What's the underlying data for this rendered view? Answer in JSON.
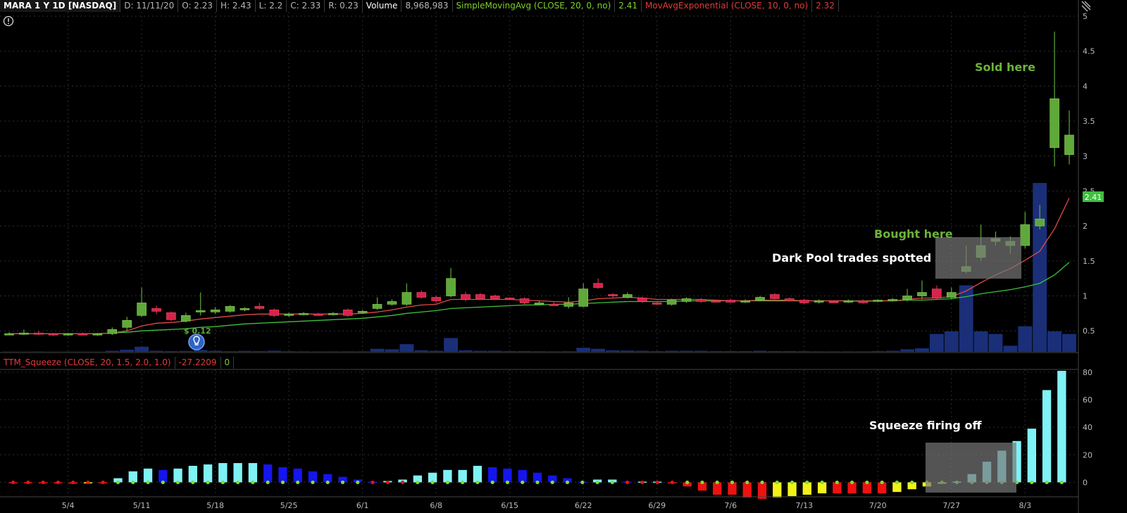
{
  "header": {
    "symbol": "MARA 1 Y 1D [NASDAQ]",
    "date": "D: 11/11/20",
    "open": "O: 2.23",
    "high": "H: 2.43",
    "low": "L: 2.2",
    "close": "C: 2.33",
    "range": "R: 0.23",
    "volume_label": "Volume",
    "volume_value": "8,968,983",
    "sma_label": "SimpleMovingAvg (CLOSE, 20, 0, no)",
    "sma_value": "2.41",
    "ema_label": "MovAvgExponential (CLOSE, 10, 0, no)",
    "ema_value": "2.32"
  },
  "squeeze_header": {
    "label": "TTM_Squeeze (CLOSE, 20, 1.5, 2.0, 1.0)",
    "value": "-27.2209",
    "signal": "0"
  },
  "price_badge": "2.41",
  "dividend_label": "$ 0.12",
  "annotations": {
    "sold": "Sold here",
    "bought": "Bought here",
    "dark_pool": "Dark Pool trades spotted",
    "squeeze": "Squeeze firing off"
  },
  "colors": {
    "up": "#5fa83a",
    "down": "#d8234a",
    "volume": "#1a2f78",
    "sma": "#3fbf3f",
    "ema": "#e04a4a",
    "grid": "#2e2e2e",
    "sq_pos_up": "#7ff2f5",
    "sq_pos_down": "#1515ee",
    "sq_neg_down": "#ee1111",
    "sq_neg_up": "#f2f21a"
  },
  "chart_data": [
    {
      "type": "candlestick",
      "x_ticks": [
        "5/4",
        "5/11",
        "5/18",
        "5/25",
        "6/1",
        "6/8",
        "6/15",
        "6/22",
        "6/29",
        "7/6",
        "7/13",
        "7/20",
        "7/27",
        "8/3"
      ],
      "y_ticks": [
        "0.5",
        "1",
        "1.5",
        "2",
        "2.5",
        "3",
        "3.5",
        "4",
        "4.5",
        "5"
      ],
      "ylim": [
        0.2,
        5
      ],
      "candles": [
        [
          0.45,
          0.48,
          0.44,
          0.46
        ],
        [
          0.46,
          0.52,
          0.44,
          0.47
        ],
        [
          0.47,
          0.5,
          0.44,
          0.46
        ],
        [
          0.46,
          0.47,
          0.43,
          0.44
        ],
        [
          0.44,
          0.47,
          0.43,
          0.46
        ],
        [
          0.46,
          0.48,
          0.44,
          0.45
        ],
        [
          0.45,
          0.47,
          0.43,
          0.46
        ],
        [
          0.46,
          0.55,
          0.44,
          0.52
        ],
        [
          0.55,
          0.7,
          0.5,
          0.65
        ],
        [
          0.72,
          1.12,
          0.7,
          0.9
        ],
        [
          0.82,
          0.86,
          0.74,
          0.78
        ],
        [
          0.76,
          0.78,
          0.64,
          0.66
        ],
        [
          0.64,
          0.76,
          0.62,
          0.72
        ],
        [
          0.77,
          1.05,
          0.72,
          0.79
        ],
        [
          0.77,
          0.84,
          0.74,
          0.8
        ],
        [
          0.78,
          0.87,
          0.76,
          0.85
        ],
        [
          0.8,
          0.84,
          0.78,
          0.82
        ],
        [
          0.85,
          0.9,
          0.8,
          0.82
        ],
        [
          0.8,
          0.82,
          0.7,
          0.72
        ],
        [
          0.73,
          0.76,
          0.7,
          0.74
        ],
        [
          0.74,
          0.77,
          0.72,
          0.75
        ],
        [
          0.74,
          0.76,
          0.72,
          0.73
        ],
        [
          0.74,
          0.77,
          0.72,
          0.75
        ],
        [
          0.8,
          0.82,
          0.7,
          0.72
        ],
        [
          0.76,
          0.8,
          0.74,
          0.78
        ],
        [
          0.82,
          0.98,
          0.8,
          0.88
        ],
        [
          0.88,
          0.95,
          0.86,
          0.92
        ],
        [
          0.88,
          1.18,
          0.86,
          1.05
        ],
        [
          1.05,
          1.08,
          0.96,
          0.98
        ],
        [
          0.98,
          1.0,
          0.9,
          0.93
        ],
        [
          1.0,
          1.4,
          0.98,
          1.25
        ],
        [
          1.02,
          1.06,
          0.92,
          0.95
        ],
        [
          1.02,
          1.04,
          0.94,
          0.96
        ],
        [
          1.0,
          1.02,
          0.94,
          0.96
        ],
        [
          0.97,
          0.98,
          0.94,
          0.95
        ],
        [
          0.96,
          0.98,
          0.88,
          0.9
        ],
        [
          0.9,
          0.93,
          0.88,
          0.9
        ],
        [
          0.88,
          0.92,
          0.86,
          0.87
        ],
        [
          0.85,
          0.98,
          0.82,
          0.9
        ],
        [
          0.85,
          1.18,
          0.84,
          1.1
        ],
        [
          1.18,
          1.25,
          1.1,
          1.12
        ],
        [
          1.02,
          1.04,
          0.98,
          1.0
        ],
        [
          0.98,
          1.05,
          0.96,
          1.02
        ],
        [
          0.97,
          0.99,
          0.9,
          0.92
        ],
        [
          0.9,
          0.92,
          0.87,
          0.88
        ],
        [
          0.88,
          0.96,
          0.86,
          0.94
        ],
        [
          0.92,
          0.98,
          0.9,
          0.96
        ],
        [
          0.95,
          0.97,
          0.9,
          0.92
        ],
        [
          0.93,
          0.95,
          0.91,
          0.92
        ],
        [
          0.94,
          0.96,
          0.9,
          0.91
        ],
        [
          0.92,
          0.95,
          0.9,
          0.93
        ],
        [
          0.94,
          1.0,
          0.92,
          0.98
        ],
        [
          1.02,
          1.04,
          0.95,
          0.96
        ],
        [
          0.96,
          0.98,
          0.92,
          0.93
        ],
        [
          0.94,
          0.96,
          0.88,
          0.9
        ],
        [
          0.91,
          0.95,
          0.89,
          0.93
        ],
        [
          0.92,
          0.94,
          0.9,
          0.91
        ],
        [
          0.92,
          0.95,
          0.9,
          0.93
        ],
        [
          0.93,
          0.95,
          0.89,
          0.9
        ],
        [
          0.92,
          0.95,
          0.91,
          0.94
        ],
        [
          0.94,
          0.97,
          0.92,
          0.95
        ],
        [
          0.95,
          1.1,
          0.92,
          1.0
        ],
        [
          1.0,
          1.22,
          0.95,
          1.05
        ],
        [
          1.1,
          1.15,
          0.95,
          0.97
        ],
        [
          0.98,
          1.12,
          0.96,
          1.05
        ],
        [
          1.35,
          1.72,
          1.32,
          1.42
        ],
        [
          1.55,
          2.02,
          1.5,
          1.72
        ],
        [
          1.78,
          1.92,
          1.72,
          1.82
        ],
        [
          1.72,
          1.85,
          1.6,
          1.78
        ],
        [
          1.72,
          2.2,
          1.68,
          2.02
        ],
        [
          2.0,
          2.3,
          1.95,
          2.1
        ],
        [
          3.12,
          4.78,
          2.85,
          3.82
        ],
        [
          3.02,
          3.65,
          2.88,
          3.3
        ]
      ]
    },
    {
      "type": "bar",
      "name": "Volume",
      "values": [
        0.06,
        0.06,
        0.07,
        0.05,
        0.06,
        0.06,
        0.05,
        0.2,
        0.4,
        1.0,
        0.2,
        0.15,
        0.18,
        0.35,
        0.2,
        0.12,
        0.18,
        0.15,
        0.22,
        0.12,
        0.1,
        0.08,
        0.09,
        0.1,
        0.1,
        0.6,
        0.5,
        1.5,
        0.3,
        0.2,
        2.7,
        0.3,
        0.2,
        0.2,
        0.15,
        0.15,
        0.12,
        0.1,
        0.12,
        0.8,
        0.6,
        0.3,
        0.25,
        0.2,
        0.15,
        0.2,
        0.2,
        0.2,
        0.15,
        0.15,
        0.15,
        0.2,
        0.15,
        0.15,
        0.12,
        0.1,
        0.1,
        0.1,
        0.1,
        0.15,
        0.2,
        0.5,
        0.7,
        3.5,
        4.0,
        13.0,
        4.0,
        3.5,
        1.2,
        5.0,
        33.0,
        4.0,
        3.5
      ]
    },
    {
      "type": "line",
      "name": "SimpleMovingAvg (CLOSE, 20, 0, no)",
      "values": [
        0.46,
        0.46,
        0.46,
        0.46,
        0.46,
        0.46,
        0.46,
        0.47,
        0.48,
        0.5,
        0.51,
        0.52,
        0.53,
        0.55,
        0.56,
        0.58,
        0.6,
        0.61,
        0.62,
        0.63,
        0.64,
        0.65,
        0.66,
        0.67,
        0.68,
        0.7,
        0.72,
        0.75,
        0.77,
        0.79,
        0.82,
        0.83,
        0.84,
        0.85,
        0.86,
        0.87,
        0.87,
        0.88,
        0.88,
        0.89,
        0.9,
        0.91,
        0.92,
        0.92,
        0.92,
        0.92,
        0.93,
        0.93,
        0.93,
        0.93,
        0.93,
        0.93,
        0.93,
        0.93,
        0.93,
        0.93,
        0.93,
        0.93,
        0.93,
        0.93,
        0.93,
        0.94,
        0.94,
        0.95,
        0.96,
        0.99,
        1.03,
        1.06,
        1.09,
        1.13,
        1.18,
        1.3,
        1.48
      ]
    },
    {
      "type": "line",
      "name": "MovAvgExponential (CLOSE, 10, 0, no)",
      "values": [
        0.46,
        0.46,
        0.46,
        0.46,
        0.46,
        0.46,
        0.46,
        0.47,
        0.5,
        0.57,
        0.61,
        0.62,
        0.64,
        0.67,
        0.69,
        0.71,
        0.73,
        0.74,
        0.74,
        0.74,
        0.74,
        0.74,
        0.74,
        0.74,
        0.75,
        0.77,
        0.8,
        0.84,
        0.87,
        0.88,
        0.95,
        0.95,
        0.95,
        0.95,
        0.95,
        0.94,
        0.93,
        0.92,
        0.91,
        0.93,
        0.96,
        0.97,
        0.98,
        0.97,
        0.95,
        0.95,
        0.95,
        0.95,
        0.94,
        0.93,
        0.93,
        0.94,
        0.94,
        0.94,
        0.93,
        0.93,
        0.93,
        0.93,
        0.92,
        0.93,
        0.93,
        0.95,
        0.97,
        0.97,
        0.99,
        1.07,
        1.19,
        1.3,
        1.39,
        1.51,
        1.64,
        1.96,
        2.4
      ]
    },
    {
      "type": "bar",
      "name": "TTM_Squeeze (CLOSE, 20, 1.5, 2.0, 1.0)",
      "y_ticks": [
        "0",
        "20",
        "40",
        "60",
        "80"
      ],
      "ylim": [
        -10,
        82
      ],
      "values": [
        -0.5,
        -0.5,
        -0.5,
        -0.5,
        -1,
        -0.5,
        -0.5,
        3,
        8,
        10,
        9,
        10,
        12,
        13,
        14,
        14,
        14,
        13,
        11,
        10,
        8,
        6,
        4,
        2,
        0.5,
        1,
        2,
        5,
        7,
        9,
        9,
        12,
        11,
        10,
        9,
        7,
        5,
        3,
        0.5,
        2,
        2,
        0.5,
        0.5,
        0.5,
        -0.5,
        -3,
        -6,
        -9,
        -9,
        -11,
        -12,
        -11,
        -10,
        -9,
        -8,
        -8,
        -8,
        -8,
        -8,
        -7,
        -5,
        -3,
        -1,
        0.5,
        6,
        15,
        23,
        30,
        39,
        67,
        81
      ],
      "squeeze_dots_red_until_index": 44
    }
  ]
}
